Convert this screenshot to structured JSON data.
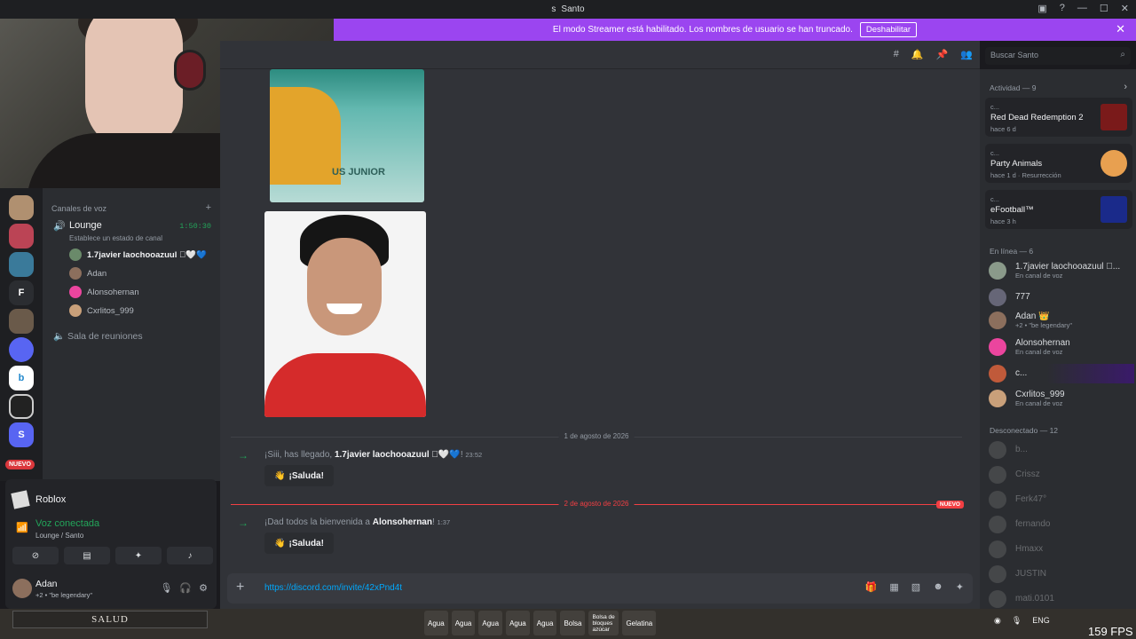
{
  "window": {
    "title": "Santo"
  },
  "banner": {
    "text": "El modo Streamer está habilitado. Los nombres de usuario se han truncado.",
    "button": "Deshabilitar"
  },
  "search": {
    "placeholder": "Buscar Santo"
  },
  "servers": {
    "folder_letter": "F",
    "s_letter": "S",
    "new_badge": "NUEVO"
  },
  "voice_channels": {
    "header": "Canales de voz",
    "lounge": {
      "name": "Lounge",
      "timer": "1:50:30",
      "status": "Establece un estado de canal"
    },
    "users": [
      "1.7javier laochooazuul 🏻🤍💙",
      "Adan",
      "Alonsohernan",
      "Cxrlitos_999"
    ],
    "meeting": "Sala de reuniones"
  },
  "bottom_panel": {
    "activity": "Roblox",
    "voice_status": "Voz conectada",
    "voice_location": "Lounge / Santo",
    "user": {
      "name": "Adan",
      "status": "+2 • \"be legendary\""
    }
  },
  "game_hud": {
    "salud": "SALUD"
  },
  "messages": {
    "image1_text": "US JUNIOR",
    "date1": "1 de agosto de 2026",
    "msg1": {
      "prefix": "¡Siii, has llegado, ",
      "user": "1.7javier laochooazuul 🏻🤍💙",
      "suffix": "!",
      "time": "23:52"
    },
    "wave_label": "¡Saluda!",
    "date2": "2 de agosto de 2026",
    "new_label": "NUEVO",
    "msg2": {
      "prefix": "¡Dad todos la bienvenida a ",
      "user": "Alonsohernan",
      "suffix": "!",
      "time": "1:37"
    }
  },
  "composer": {
    "value": "https://discord.com/invite/42xPnd4t"
  },
  "members": {
    "activity_header": "Actividad — 9",
    "activities": [
      {
        "who": "c...",
        "game": "Red Dead Redemption 2",
        "ago": "hace 6 d",
        "extra": ""
      },
      {
        "who": "c...",
        "game": "Party Animals",
        "ago": "hace 1 d",
        "extra": "Resurrección"
      },
      {
        "who": "c...",
        "game": "eFootball™",
        "ago": "hace 3 h",
        "extra": ""
      }
    ],
    "online_header": "En línea — 6",
    "online": [
      {
        "name": "1.7javier laochooazuul 🏻...",
        "sub": "En canal de voz"
      },
      {
        "name": "777",
        "sub": ""
      },
      {
        "name": "Adan 👑",
        "sub": "+2 • \"be legendary\""
      },
      {
        "name": "Alonsohernan",
        "sub": "En canal de voz"
      },
      {
        "name": "c...",
        "sub": ""
      },
      {
        "name": "Cxrlitos_999",
        "sub": "En canal de voz"
      }
    ],
    "offline_header": "Desconectado — 12",
    "offline": [
      "b...",
      "Crissz",
      "Ferk47°",
      "fernando",
      "Hmaxx",
      "JUSTIN",
      "mati.0101"
    ]
  },
  "taskbar": {
    "items": [
      "Agua",
      "Agua",
      "Agua",
      "Agua",
      "Agua",
      "Bolsa",
      "Bolsa de bloques azúcar",
      "Gelatina"
    ],
    "lang": "ENG",
    "fps": "159 FPS"
  }
}
